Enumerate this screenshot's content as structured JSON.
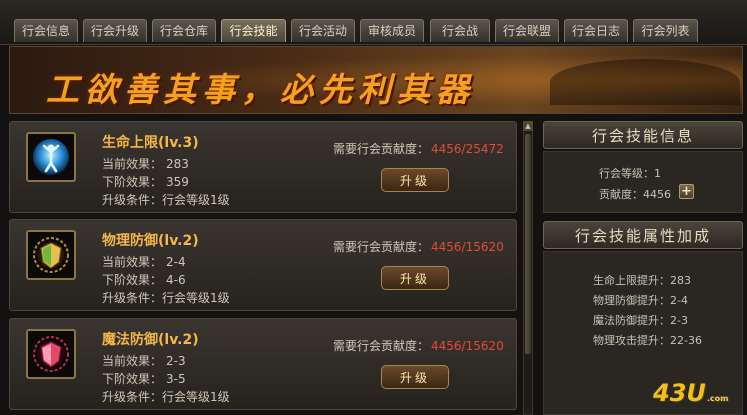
{
  "tabs": [
    {
      "label": "行会信息",
      "active": false
    },
    {
      "label": "行会升级",
      "active": false
    },
    {
      "label": "行会仓库",
      "active": false
    },
    {
      "label": "行会技能",
      "active": true
    },
    {
      "label": "行会活动",
      "active": false
    },
    {
      "label": "审核成员",
      "active": false
    },
    {
      "label": "行会战",
      "active": false
    },
    {
      "label": "行会联盟",
      "active": false
    },
    {
      "label": "行会日志",
      "active": false
    },
    {
      "label": "行会列表",
      "active": false
    }
  ],
  "banner": {
    "title": "工欲善其事，必先利其器"
  },
  "skills": [
    {
      "name": "生命上限(lv.3)",
      "icon": "life-limit-icon",
      "current_label": "当前效果：",
      "current_value": "283",
      "next_label": "下阶效果：",
      "next_value": "359",
      "condition_label": "升级条件：",
      "condition_value": "行会等级1级",
      "req_label": "需要行会贡献度：",
      "req_value": "4456/25472",
      "button": "升级"
    },
    {
      "name": "物理防御(lv.2)",
      "icon": "physical-defense-icon",
      "current_label": "当前效果：",
      "current_value": "2-4",
      "next_label": "下阶效果：",
      "next_value": "4-6",
      "condition_label": "升级条件：",
      "condition_value": "行会等级1级",
      "req_label": "需要行会贡献度：",
      "req_value": "4456/15620",
      "button": "升级"
    },
    {
      "name": "魔法防御(lv.2)",
      "icon": "magic-defense-icon",
      "current_label": "当前效果：",
      "current_value": "2-3",
      "next_label": "下阶效果：",
      "next_value": "3-5",
      "condition_label": "升级条件：",
      "condition_value": "行会等级1级",
      "req_label": "需要行会贡献度：",
      "req_value": "4456/15620",
      "button": "升级"
    }
  ],
  "info_panel": {
    "title": "行会技能信息",
    "level_label": "行会等级：",
    "level_value": "1",
    "contribution_label": "贡献度：",
    "contribution_value": "4456",
    "plus": "+"
  },
  "bonus_panel": {
    "title": "行会技能属性加成",
    "items": [
      {
        "label": "生命上限提升：",
        "value": "283"
      },
      {
        "label": "物理防御提升：",
        "value": "2-4"
      },
      {
        "label": "魔法防御提升：",
        "value": "2-3"
      },
      {
        "label": "物理攻击提升：",
        "value": "22-36"
      }
    ]
  },
  "logo": {
    "text": "43U",
    "suffix": ".com"
  },
  "colors": {
    "accent": "#f3b64a",
    "requirement": "#e24a3a",
    "banner_text": "#f6a020"
  }
}
